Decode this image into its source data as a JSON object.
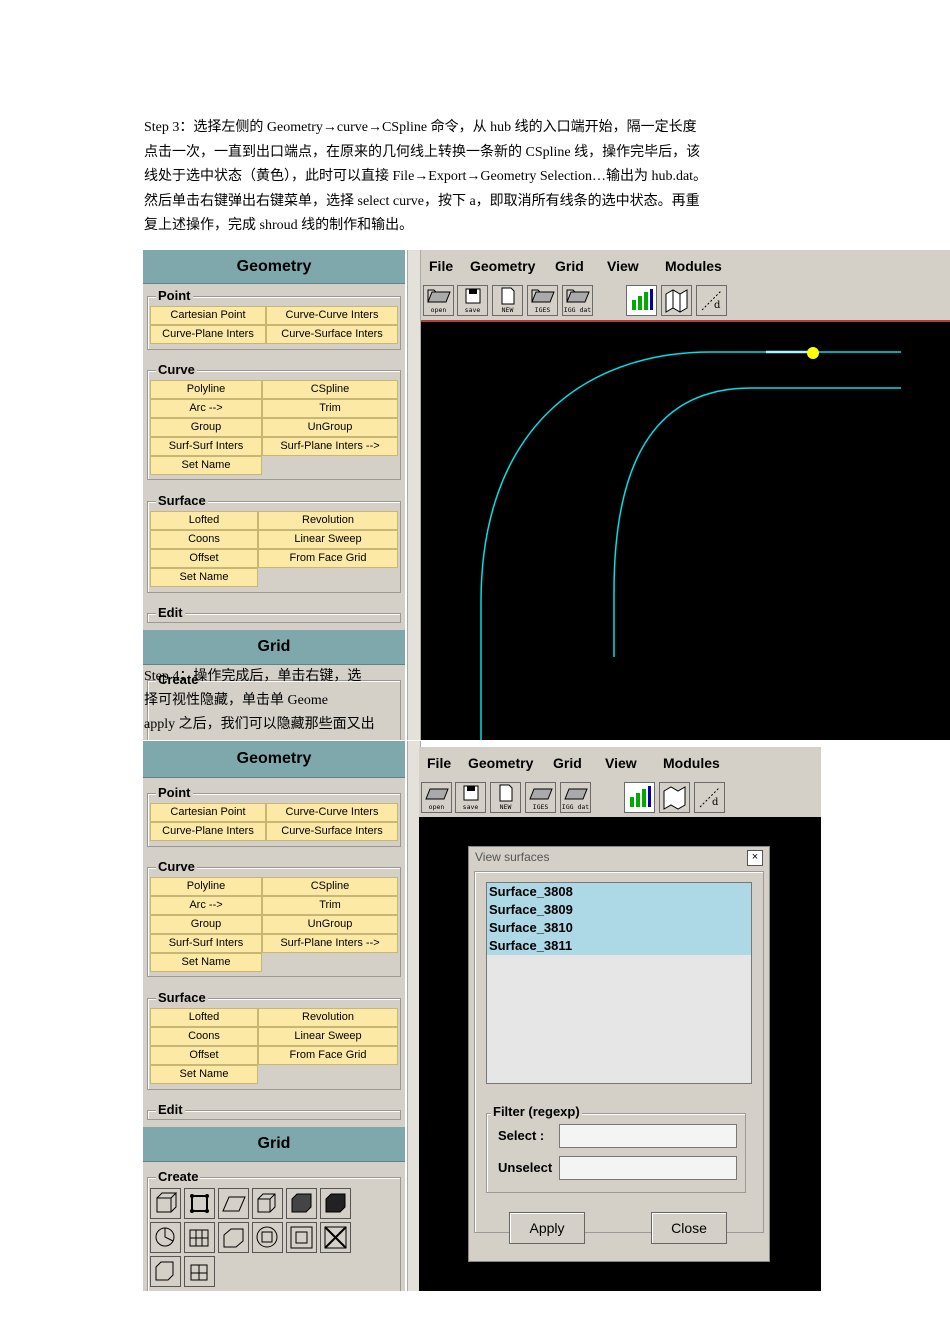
{
  "paragraph": {
    "lines": [
      "Step 3：选择左侧的 Geometry→curve→CSpline 命令，从 hub 线的入口端开始，隔一定长度",
      "点击一次，一直到出口端点，在原来的几何线上转换一条新的 CSpline 线，操作完毕后，该",
      "线处于选中状态（黄色），此时可以直接 File→Export→Geometry Selection…输出为 hub.dat。",
      "然后单击右键弹出右键菜单，选择 select curve，按下 a，即取消所有线条的选中状态。再重",
      "复上述操作，完成 shroud 线的制作和输出。"
    ]
  },
  "step4": {
    "lines": [
      "Step 4：操作完成后，单击右键，选",
      "择可视性隐藏，单击单 Geome",
      "apply 之后，我们可以隐藏那些面又出"
    ]
  },
  "shot1": {
    "panel_title": "Geometry",
    "grid_title": "Grid",
    "groups": {
      "point": "Point",
      "curve": "Curve",
      "surface": "Surface",
      "edit": "Edit",
      "create": "Create"
    },
    "point_buttons": [
      "Cartesian Point",
      "Curve-Curve Inters",
      "Curve-Plane Inters",
      "Curve-Surface Inters"
    ],
    "curve_buttons": [
      "Polyline",
      "CSpline",
      "Arc -->",
      "Trim",
      "Group",
      "UnGroup",
      "Surf-Surf  Inters",
      "Surf-Plane Inters  -->",
      "Set Name"
    ],
    "surface_buttons": [
      "Lofted",
      "Revolution",
      "Coons",
      "Linear Sweep",
      "Offset",
      "From Face Grid",
      "Set Name"
    ],
    "menu": [
      "File",
      "Geometry",
      "Grid",
      "View",
      "Modules"
    ],
    "toolbar": [
      "open",
      "save",
      "NEW",
      "IGES",
      "IGG dat"
    ]
  },
  "shot2": {
    "panel_title": "Geometry",
    "grid_title": "Grid",
    "groups": {
      "point": "Point",
      "curve": "Curve",
      "surface": "Surface",
      "edit": "Edit",
      "create": "Create"
    },
    "point_buttons": [
      "Cartesian Point",
      "Curve-Curve Inters",
      "Curve-Plane Inters",
      "Curve-Surface Inters"
    ],
    "curve_buttons": [
      "Polyline",
      "CSpline",
      "Arc -->",
      "Trim",
      "Group",
      "UnGroup",
      "Surf-Surf  Inters",
      "Surf-Plane Inters  -->",
      "Set Name"
    ],
    "surface_buttons": [
      "Lofted",
      "Revolution",
      "Coons",
      "Linear Sweep",
      "Offset",
      "From Face Grid",
      "Set Name"
    ],
    "menu": [
      "File",
      "Geometry",
      "Grid",
      "View",
      "Modules"
    ],
    "toolbar": [
      "open",
      "save",
      "NEW",
      "IGES",
      "IGG dat"
    ],
    "dialog": {
      "title": "View surfaces",
      "close_glyph": "×",
      "items": [
        "Surface_3808",
        "Surface_3809",
        "Surface_3810",
        "Surface_3811"
      ],
      "filter_label": "Filter (regexp)",
      "select_label": "Select :",
      "unselect_label": "Unselect",
      "select_value": "",
      "unselect_value": "",
      "apply_label": "Apply",
      "close_label": "Close"
    }
  },
  "colors": {
    "panel_bg": "#d4d0c8",
    "title_bg": "#7fa8ad",
    "button_bg": "#fde9a6",
    "curve": "#00e0e8",
    "selected_point": "#ffff00",
    "list_selection": "#add8e6"
  }
}
